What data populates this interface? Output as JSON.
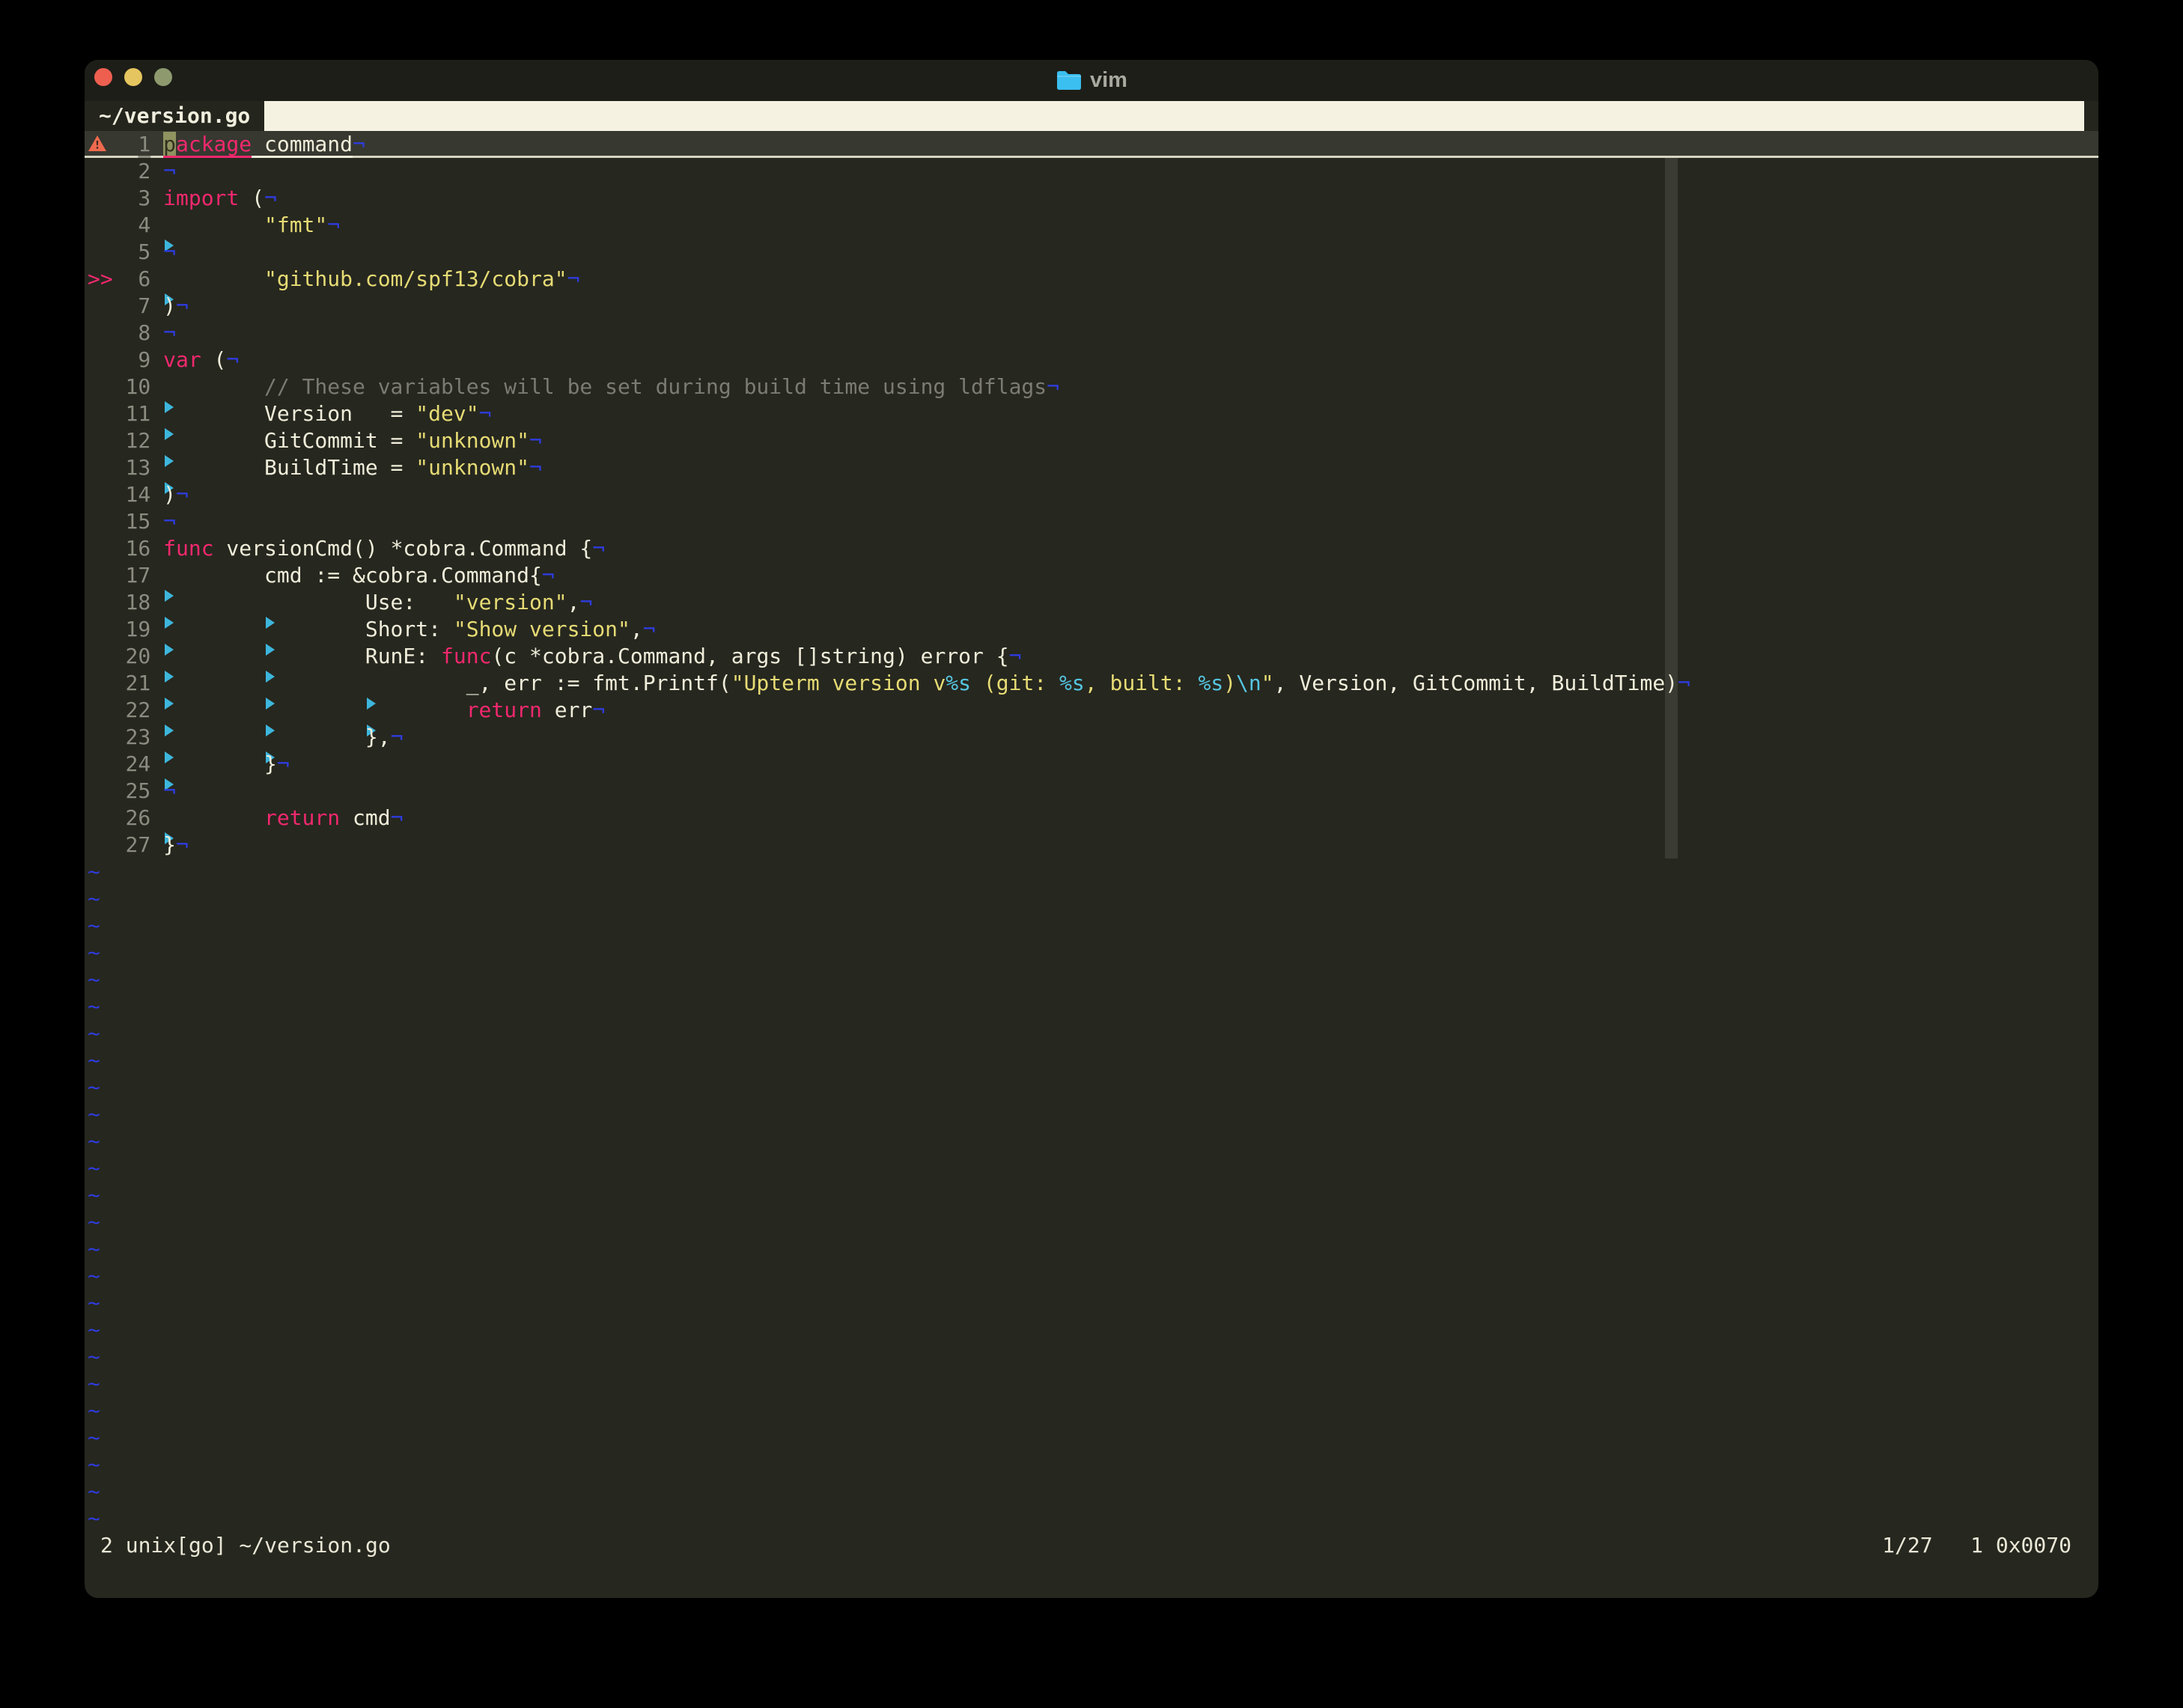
{
  "window": {
    "title": "vim"
  },
  "tabline": {
    "active_tab": "~/version.go"
  },
  "palette": {
    "bg": "#26271f",
    "titlebar_bg": "#1d1e18",
    "tab_label_bg": "#24251d",
    "tabline_fill": "#f5f2e1",
    "text": "#f0edda",
    "keyword": "#f1286e",
    "string": "#e6db74",
    "special": "#55c5e0",
    "comment": "#7b7b72",
    "line_number": "#8b8b80",
    "eol_blue": "#2e3cdf",
    "tab_arrow": "#3db6dc",
    "cursor_bg": "#8f935f",
    "cursorline_bg": "#373830",
    "colorcolumn_bg": "#3a3b32",
    "sign_change": "#f1286e",
    "sign_warning": "#ee6a4e",
    "traffic_red": "#ef5f50",
    "traffic_yellow": "#e5c55f",
    "traffic_green": "#8e9a6e",
    "folder_icon": "#3bbef0"
  },
  "editor": {
    "eol_char": "¬",
    "filler_char": "~",
    "filler_count": 25,
    "colorcolumn": 120,
    "lines": [
      {
        "num": 1,
        "sign": "warning",
        "cursorline": true,
        "tokens": [
          [
            "cur",
            "p"
          ],
          [
            "kul",
            "ackage"
          ],
          [
            "tul",
            " command"
          ]
        ]
      },
      {
        "num": 2,
        "tokens": []
      },
      {
        "num": 3,
        "tokens": [
          [
            "k",
            "import"
          ],
          [
            "t",
            " ("
          ]
        ]
      },
      {
        "num": 4,
        "tokens": [
          [
            "tab",
            ""
          ],
          [
            "s",
            "\"fmt\""
          ]
        ]
      },
      {
        "num": 5,
        "tokens": []
      },
      {
        "num": 6,
        "sign": "changed",
        "tokens": [
          [
            "tab",
            ""
          ],
          [
            "s",
            "\"github.com/spf13/cobra\""
          ]
        ]
      },
      {
        "num": 7,
        "tokens": [
          [
            "t",
            ")"
          ]
        ]
      },
      {
        "num": 8,
        "tokens": []
      },
      {
        "num": 9,
        "tokens": [
          [
            "k",
            "var"
          ],
          [
            "t",
            " ("
          ]
        ]
      },
      {
        "num": 10,
        "tokens": [
          [
            "tab",
            ""
          ],
          [
            "c",
            "// These variables will be set during build time using ldflags"
          ]
        ]
      },
      {
        "num": 11,
        "tokens": [
          [
            "tab",
            ""
          ],
          [
            "t",
            "Version   = "
          ],
          [
            "s",
            "\"dev\""
          ]
        ]
      },
      {
        "num": 12,
        "tokens": [
          [
            "tab",
            ""
          ],
          [
            "t",
            "GitCommit = "
          ],
          [
            "s",
            "\"unknown\""
          ]
        ]
      },
      {
        "num": 13,
        "tokens": [
          [
            "tab",
            ""
          ],
          [
            "t",
            "BuildTime = "
          ],
          [
            "s",
            "\"unknown\""
          ]
        ]
      },
      {
        "num": 14,
        "tokens": [
          [
            "t",
            ")"
          ]
        ]
      },
      {
        "num": 15,
        "tokens": []
      },
      {
        "num": 16,
        "tokens": [
          [
            "k",
            "func"
          ],
          [
            "t",
            " versionCmd() *cobra.Command {"
          ]
        ]
      },
      {
        "num": 17,
        "tokens": [
          [
            "tab",
            ""
          ],
          [
            "t",
            "cmd := &cobra.Command{"
          ]
        ]
      },
      {
        "num": 18,
        "tokens": [
          [
            "tab",
            ""
          ],
          [
            "tab",
            ""
          ],
          [
            "t",
            "Use:   "
          ],
          [
            "s",
            "\"version\""
          ],
          [
            "t",
            ","
          ]
        ]
      },
      {
        "num": 19,
        "tokens": [
          [
            "tab",
            ""
          ],
          [
            "tab",
            ""
          ],
          [
            "t",
            "Short: "
          ],
          [
            "s",
            "\"Show version\""
          ],
          [
            "t",
            ","
          ]
        ]
      },
      {
        "num": 20,
        "tokens": [
          [
            "tab",
            ""
          ],
          [
            "tab",
            ""
          ],
          [
            "t",
            "RunE: "
          ],
          [
            "k",
            "func"
          ],
          [
            "t",
            "(c *cobra.Command, args []string) error {"
          ]
        ]
      },
      {
        "num": 21,
        "tokens": [
          [
            "tab",
            ""
          ],
          [
            "tab",
            ""
          ],
          [
            "tab",
            ""
          ],
          [
            "t",
            "_, err := fmt.Printf("
          ],
          [
            "s",
            "\"Upterm version v"
          ],
          [
            "p",
            "%s"
          ],
          [
            "s",
            " (git: "
          ],
          [
            "p",
            "%s"
          ],
          [
            "s",
            ", built: "
          ],
          [
            "p",
            "%s"
          ],
          [
            "s",
            ")"
          ],
          [
            "p",
            "\\n"
          ],
          [
            "s",
            "\""
          ],
          [
            "t",
            ", Version, GitCommit, BuildTime)"
          ]
        ]
      },
      {
        "num": 22,
        "tokens": [
          [
            "tab",
            ""
          ],
          [
            "tab",
            ""
          ],
          [
            "tab",
            ""
          ],
          [
            "k",
            "return"
          ],
          [
            "t",
            " err"
          ]
        ]
      },
      {
        "num": 23,
        "tokens": [
          [
            "tab",
            ""
          ],
          [
            "tab",
            ""
          ],
          [
            "t",
            "},"
          ]
        ]
      },
      {
        "num": 24,
        "tokens": [
          [
            "tab",
            ""
          ],
          [
            "t",
            "}"
          ]
        ]
      },
      {
        "num": 25,
        "tokens": []
      },
      {
        "num": 26,
        "tokens": [
          [
            "tab",
            ""
          ],
          [
            "k",
            "return"
          ],
          [
            "t",
            " cmd"
          ]
        ]
      },
      {
        "num": 27,
        "tokens": [
          [
            "t",
            "}"
          ]
        ]
      }
    ]
  },
  "statusline": {
    "left": "2 unix[go] ~/version.go",
    "right": "1/27   1 0x0070"
  }
}
